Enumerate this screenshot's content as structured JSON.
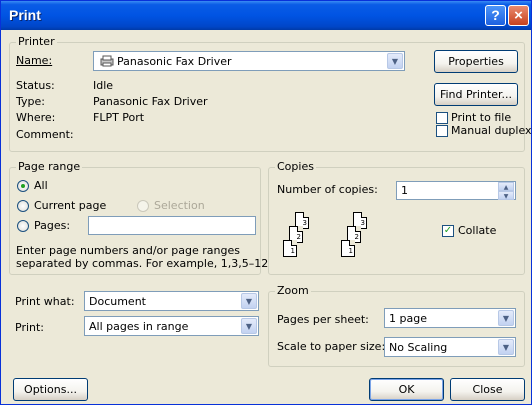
{
  "window": {
    "title": "Print",
    "help_glyph": "?",
    "close_glyph": "×"
  },
  "printer": {
    "legend": "Printer",
    "name_label": "Name:",
    "name_value": "Panasonic Fax Driver",
    "status_label": "Status:",
    "status_value": "Idle",
    "type_label": "Type:",
    "type_value": "Panasonic Fax Driver",
    "where_label": "Where:",
    "where_value": "FLPT Port",
    "comment_label": "Comment:",
    "properties_button": "Properties",
    "find_printer_button": "Find Printer...",
    "print_to_file_label": "Print to file",
    "manual_duplex_label": "Manual duplex",
    "print_to_file_checked": false,
    "manual_duplex_checked": false
  },
  "page_range": {
    "legend": "Page range",
    "all_label": "All",
    "current_page_label": "Current page",
    "selection_label": "Selection",
    "pages_label": "Pages:",
    "pages_value": "",
    "help_line1": "Enter page numbers and/or page ranges",
    "help_line2": "separated by commas.  For example, 1,3,5–12",
    "selected": "all"
  },
  "copies": {
    "legend": "Copies",
    "number_label": "Number of copies:",
    "number_value": "1",
    "collate_label": "Collate",
    "collate_checked": true,
    "page_numbers": [
      "1",
      "2",
      "3"
    ]
  },
  "print_what": {
    "label": "Print what:",
    "value": "Document"
  },
  "print": {
    "label": "Print:",
    "value": "All pages in range"
  },
  "zoom": {
    "legend": "Zoom",
    "pages_per_sheet_label": "Pages per sheet:",
    "pages_per_sheet_value": "1 page",
    "scale_label": "Scale to paper size:",
    "scale_value": "No Scaling"
  },
  "buttons": {
    "options": "Options...",
    "ok": "OK",
    "close": "Close"
  }
}
